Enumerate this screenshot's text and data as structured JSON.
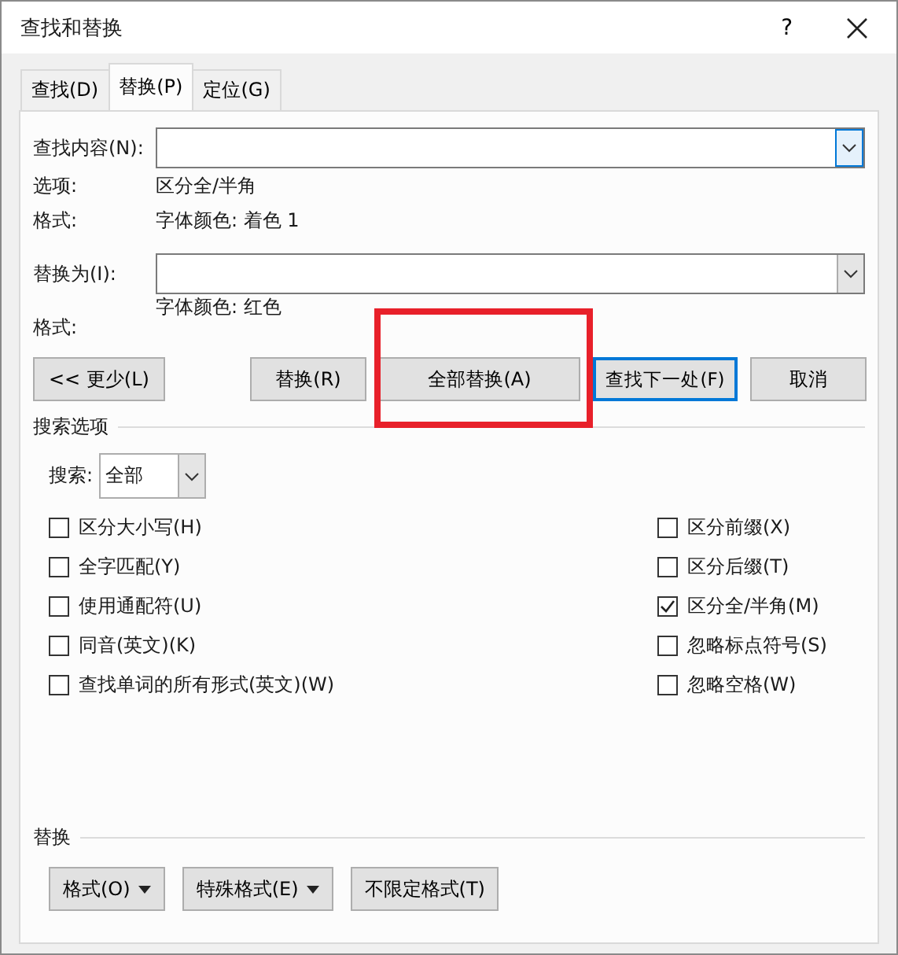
{
  "window": {
    "title": "查找和替换",
    "help": "?"
  },
  "tabs": [
    {
      "label": "查找(D)",
      "selected": false
    },
    {
      "label": "替换(P)",
      "selected": true
    },
    {
      "label": "定位(G)",
      "selected": false
    }
  ],
  "find": {
    "label": "查找内容(N):",
    "focused": true,
    "options_label": "选项:",
    "options_value": "区分全/半角",
    "format_label": "格式:",
    "format_value": "字体颜色: 着色 1"
  },
  "replace": {
    "label": "替换为(I):",
    "format_label": "格式:",
    "format_value": "字体颜色: 红色"
  },
  "buttons": [
    {
      "label": "<< 更少(L)",
      "default": false,
      "highlighted": false
    },
    {
      "label": "替换(R)",
      "default": false,
      "highlighted": false
    },
    {
      "label": "全部替换(A)",
      "default": false,
      "highlighted": true
    },
    {
      "label": "查找下一处(F)",
      "default": true,
      "highlighted": false
    },
    {
      "label": "取消",
      "default": false,
      "highlighted": false
    }
  ],
  "search_options": {
    "title": "搜索选项",
    "search_label": "搜索:",
    "search_value": "全部",
    "left": [
      {
        "label": "区分大小写(H)",
        "checked": false
      },
      {
        "label": "全字匹配(Y)",
        "checked": false
      },
      {
        "label": "使用通配符(U)",
        "checked": false
      },
      {
        "label": "同音(英文)(K)",
        "checked": false
      },
      {
        "label": "查找单词的所有形式(英文)(W)",
        "checked": false
      }
    ],
    "right": [
      {
        "label": "区分前缀(X)",
        "checked": false
      },
      {
        "label": "区分后缀(T)",
        "checked": false
      },
      {
        "label": "区分全/半角(M)",
        "checked": true
      },
      {
        "label": "忽略标点符号(S)",
        "checked": false
      },
      {
        "label": "忽略空格(W)",
        "checked": false
      }
    ]
  },
  "replace_section": {
    "title": "替换",
    "buttons": [
      {
        "label": "格式(O)",
        "dropdown": true
      },
      {
        "label": "特殊格式(E)",
        "dropdown": true
      },
      {
        "label": "不限定格式(T)",
        "dropdown": false
      }
    ]
  }
}
